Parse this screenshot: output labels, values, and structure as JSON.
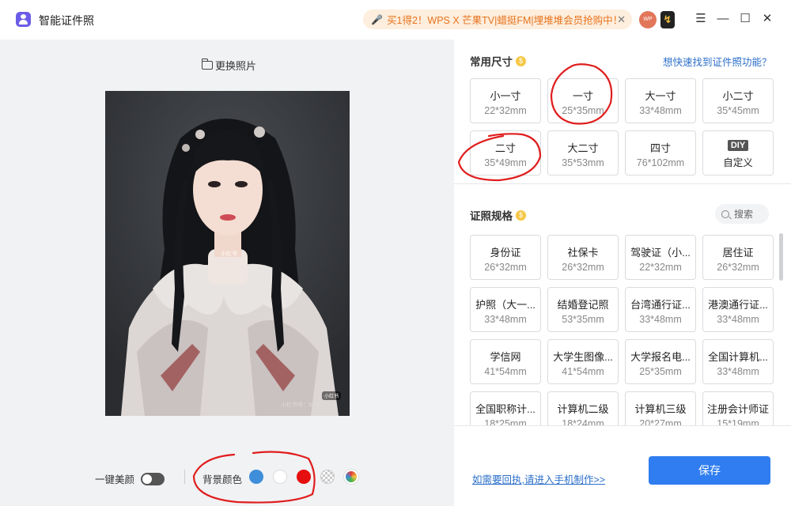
{
  "app": {
    "title": "智能证件照"
  },
  "promo": {
    "text": "买1得2！WPS X 芒果TV|蜡挺FM|埋堆堆会员抢购中！"
  },
  "account": {
    "avatar_text": "WP"
  },
  "left": {
    "change_photo": "更换照片",
    "photo_watermark": "小红书",
    "photo_watermark_id": "小红书号：314252914",
    "beauty_label": "一键美颜",
    "bg_color_label": "背景颜色",
    "bg_colors": [
      "#3e8ed9",
      "#ffffff",
      "#e50f0f"
    ]
  },
  "common": {
    "title": "常用尺寸",
    "help_link": "想快速找到证件照功能？",
    "sizes": [
      {
        "name": "小一寸",
        "size": "22*32mm"
      },
      {
        "name": "一寸",
        "size": "25*35mm"
      },
      {
        "name": "大一寸",
        "size": "33*48mm"
      },
      {
        "name": "小二寸",
        "size": "35*45mm"
      },
      {
        "name": "二寸",
        "size": "35*49mm"
      },
      {
        "name": "大二寸",
        "size": "35*53mm"
      },
      {
        "name": "四寸",
        "size": "76*102mm"
      }
    ],
    "diy_badge": "DIY",
    "diy_label": "自定义"
  },
  "specs": {
    "title": "证照规格",
    "search_placeholder": "搜索",
    "items": [
      {
        "name": "身份证",
        "size": "26*32mm"
      },
      {
        "name": "社保卡",
        "size": "26*32mm"
      },
      {
        "name": "驾驶证（小...",
        "size": "22*32mm"
      },
      {
        "name": "居住证",
        "size": "26*32mm"
      },
      {
        "name": "护照（大一...",
        "size": "33*48mm"
      },
      {
        "name": "结婚登记照",
        "size": "53*35mm"
      },
      {
        "name": "台湾通行证...",
        "size": "33*48mm"
      },
      {
        "name": "港澳通行证...",
        "size": "33*48mm"
      },
      {
        "name": "学信网",
        "size": "41*54mm"
      },
      {
        "name": "大学生图像...",
        "size": "41*54mm"
      },
      {
        "name": "大学报名电...",
        "size": "25*35mm"
      },
      {
        "name": "全国计算机...",
        "size": "33*48mm"
      },
      {
        "name": "全国职称计...",
        "size": "18*25mm"
      },
      {
        "name": "计算机二级",
        "size": "18*24mm"
      },
      {
        "name": "计算机三级",
        "size": "20*27mm"
      },
      {
        "name": "注册会计师证",
        "size": "15*19mm"
      }
    ]
  },
  "footer": {
    "phone_link": "如需要回执,请进入手机制作>>",
    "save": "保存"
  }
}
